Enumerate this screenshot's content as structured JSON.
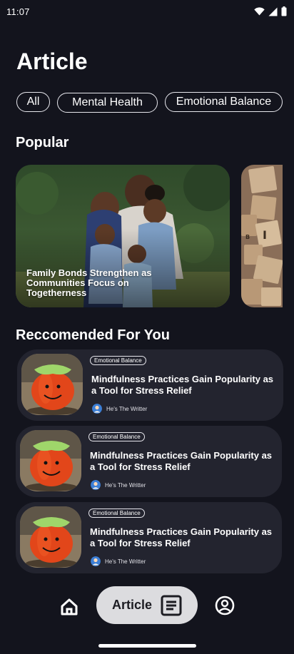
{
  "status_bar": {
    "time": "11:07"
  },
  "header": {
    "title": "Article"
  },
  "filters": [
    {
      "label": "All"
    },
    {
      "label": "Mental Health"
    },
    {
      "label": "Emotional Balance"
    }
  ],
  "popular": {
    "title": "Popular",
    "cards": [
      {
        "caption": "Family Bonds Strengthen as Communities Focus on Togetherness"
      }
    ]
  },
  "recommended": {
    "title": "Reccomended For You",
    "items": [
      {
        "badge": "Emotional Balance",
        "title": "Mindfulness Practices Gain Popularity as a Tool for Stress Relief",
        "author": "He's The Writter"
      },
      {
        "badge": "Emotional Balance",
        "title": "Mindfulness Practices Gain Popularity as a Tool for Stress Relief",
        "author": "He's The Writter"
      },
      {
        "badge": "Emotional Balance",
        "title": "Mindfulness Practices Gain Popularity as a Tool for Stress Relief",
        "author": "He's The Writter"
      }
    ]
  },
  "bottom_nav": {
    "active_label": "Article",
    "items": [
      "home-icon",
      "article-icon",
      "profile-icon"
    ]
  },
  "colors": {
    "background": "#13141d",
    "card": "#23242f",
    "nav_active": "#dcdcdf"
  }
}
